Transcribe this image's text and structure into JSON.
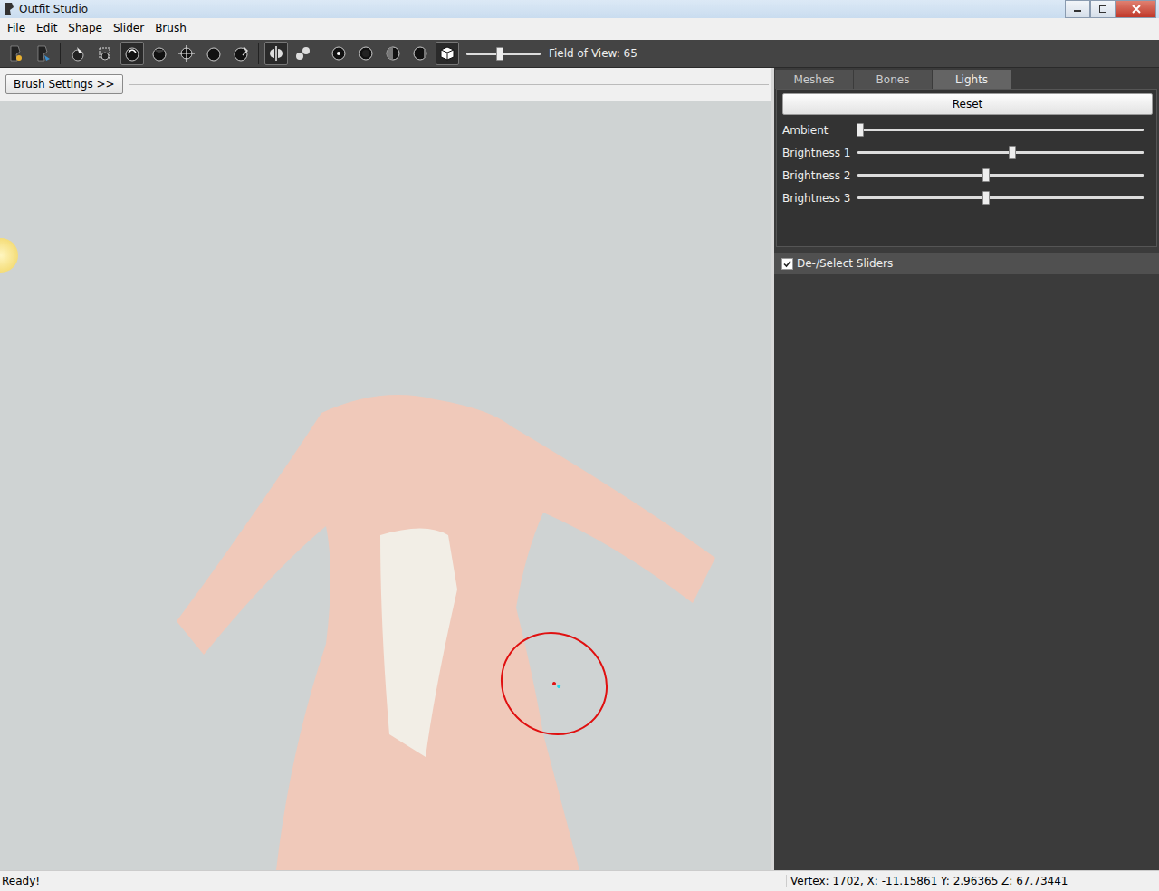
{
  "window": {
    "title": "Outfit Studio"
  },
  "menu": [
    "File",
    "Edit",
    "Shape",
    "Slider",
    "Brush"
  ],
  "toolbar": {
    "groups": [
      [
        {
          "kind": "project",
          "selected": false
        },
        {
          "kind": "outfit",
          "selected": false
        }
      ],
      [
        {
          "kind": "select",
          "selected": false
        },
        {
          "kind": "mask",
          "selected": false
        },
        {
          "kind": "inflate",
          "selected": true
        },
        {
          "kind": "deflate",
          "selected": false
        },
        {
          "kind": "move",
          "selected": false
        },
        {
          "kind": "smooth",
          "selected": false
        },
        {
          "kind": "weight",
          "selected": false
        }
      ],
      [
        {
          "kind": "mirror",
          "selected": true
        },
        {
          "kind": "connected",
          "selected": false
        }
      ],
      [
        {
          "kind": "dot-small",
          "selected": false
        },
        {
          "kind": "dot-medium",
          "selected": false
        },
        {
          "kind": "dot-half",
          "selected": false
        },
        {
          "kind": "dot-side",
          "selected": false
        },
        {
          "kind": "cube",
          "selected": true
        }
      ]
    ],
    "fov": {
      "label": "Field of View: 65",
      "level": 0.45
    }
  },
  "brush_settings_button": "Brush Settings >>",
  "tabs": [
    {
      "label": "Meshes",
      "selected": false
    },
    {
      "label": "Bones",
      "selected": false
    },
    {
      "label": "Lights",
      "selected": true
    }
  ],
  "lights": {
    "reset": "Reset",
    "sliders": [
      {
        "label": "Ambient",
        "level": 0.01
      },
      {
        "label": "Brightness 1",
        "level": 0.54
      },
      {
        "label": "Brightness 2",
        "level": 0.45
      },
      {
        "label": "Brightness 3",
        "level": 0.45
      }
    ]
  },
  "sliders_panel": {
    "label": "De-/Select Sliders",
    "checked": true
  },
  "status_bar": {
    "left": "Ready!",
    "right": "Vertex: 1702, X: -11.15861 Y: 2.96365 Z: 67.73441"
  }
}
